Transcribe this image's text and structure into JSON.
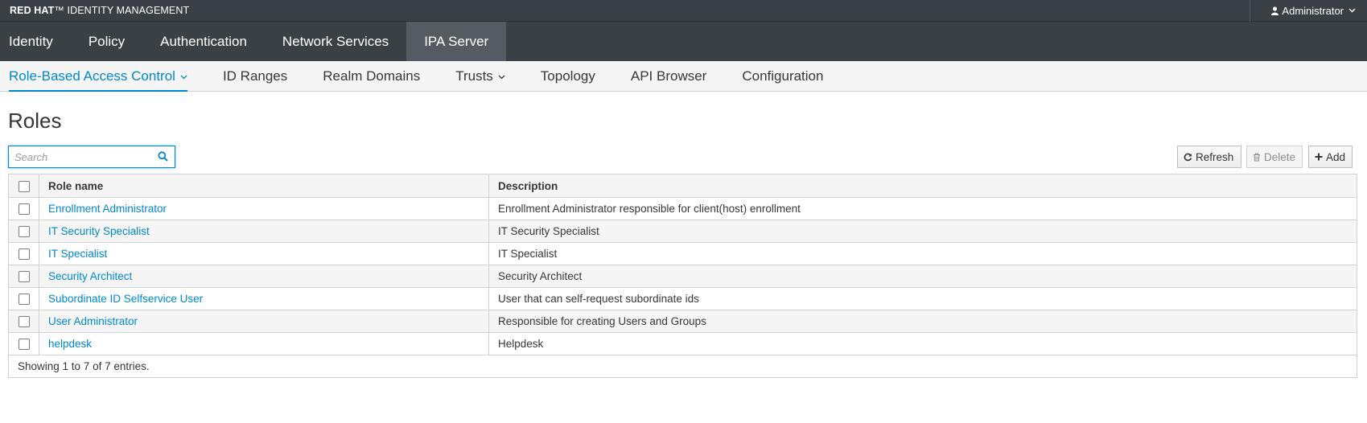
{
  "brand": {
    "bold": "RED HAT",
    "rest": "IDENTITY MANAGEMENT"
  },
  "user": {
    "name": "Administrator"
  },
  "nav_primary": [
    {
      "label": "Identity",
      "active": false
    },
    {
      "label": "Policy",
      "active": false
    },
    {
      "label": "Authentication",
      "active": false
    },
    {
      "label": "Network Services",
      "active": false
    },
    {
      "label": "IPA Server",
      "active": true
    }
  ],
  "nav_secondary": [
    {
      "label": "Role-Based Access Control",
      "active": true,
      "dropdown": true
    },
    {
      "label": "ID Ranges",
      "active": false,
      "dropdown": false
    },
    {
      "label": "Realm Domains",
      "active": false,
      "dropdown": false
    },
    {
      "label": "Trusts",
      "active": false,
      "dropdown": true
    },
    {
      "label": "Topology",
      "active": false,
      "dropdown": false
    },
    {
      "label": "API Browser",
      "active": false,
      "dropdown": false
    },
    {
      "label": "Configuration",
      "active": false,
      "dropdown": false
    }
  ],
  "page": {
    "title": "Roles"
  },
  "search": {
    "placeholder": "Search",
    "value": ""
  },
  "actions": {
    "refresh": "Refresh",
    "delete": "Delete",
    "add": "Add"
  },
  "table": {
    "columns": [
      "Role name",
      "Description"
    ],
    "rows": [
      {
        "name": "Enrollment Administrator",
        "description": "Enrollment Administrator responsible for client(host) enrollment"
      },
      {
        "name": "IT Security Specialist",
        "description": "IT Security Specialist"
      },
      {
        "name": "IT Specialist",
        "description": "IT Specialist"
      },
      {
        "name": "Security Architect",
        "description": "Security Architect"
      },
      {
        "name": "Subordinate ID Selfservice User",
        "description": "User that can self-request subordinate ids"
      },
      {
        "name": "User Administrator",
        "description": "Responsible for creating Users and Groups"
      },
      {
        "name": "helpdesk",
        "description": "Helpdesk"
      }
    ],
    "footer": "Showing 1 to 7 of 7 entries."
  },
  "colors": {
    "accent": "#0088ce",
    "topbar": "#393f44",
    "nav_active": "#555b60"
  }
}
